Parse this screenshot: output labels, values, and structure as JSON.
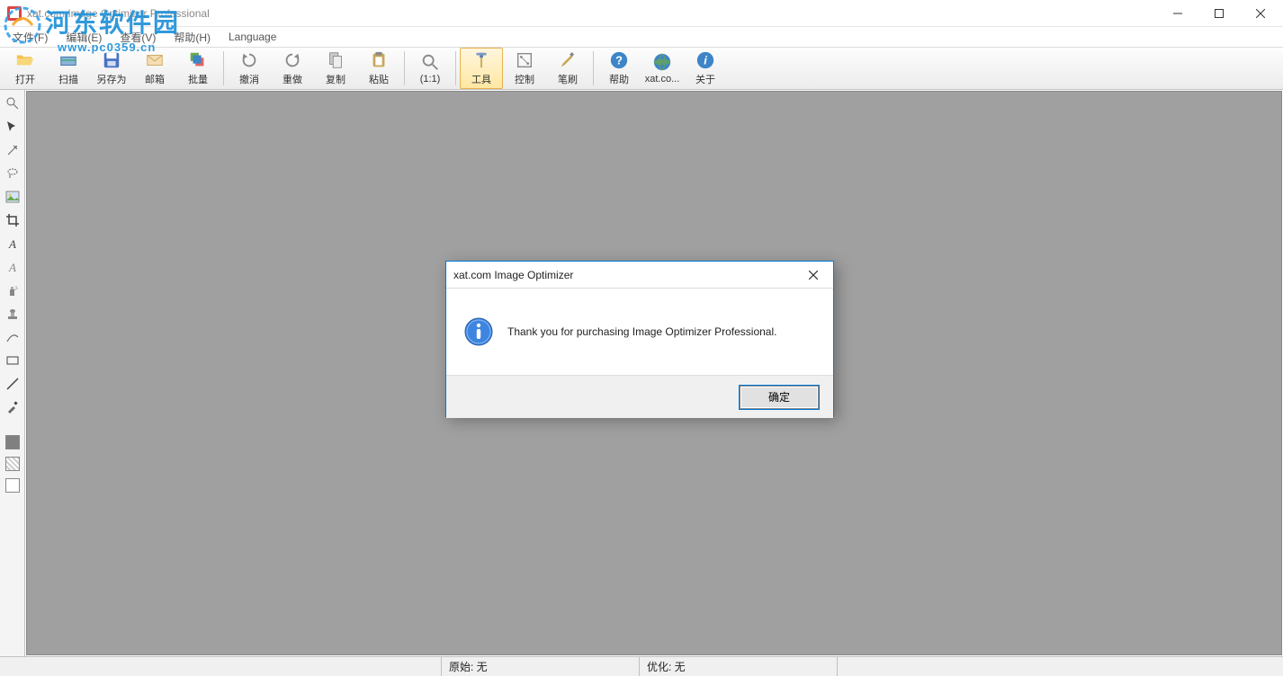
{
  "window": {
    "title": "xat.com  Image Optimizer Professional"
  },
  "menu": {
    "file": "文件(F)",
    "edit": "编辑(E)",
    "view": "查看(V)",
    "help": "帮助(H)",
    "language": "Language"
  },
  "toolbar": {
    "open": "打开",
    "scan": "扫描",
    "saveas": "另存为",
    "mail": "邮箱",
    "batch": "批量",
    "undo": "撤消",
    "redo": "重做",
    "copy": "复制",
    "paste": "粘贴",
    "onetoone": "(1:1)",
    "tools": "工具",
    "control": "控制",
    "brush": "笔刷",
    "helpbtn": "帮助",
    "xatcom": "xat.co...",
    "about": "关于"
  },
  "status": {
    "original": "原始: 无",
    "optimized": "优化: 无"
  },
  "dialog": {
    "title": "xat.com Image Optimizer",
    "message": "Thank you for purchasing Image Optimizer Professional.",
    "ok": "确定"
  },
  "watermark": {
    "text": "河东软件园",
    "url": "www.pc0359.cn"
  }
}
